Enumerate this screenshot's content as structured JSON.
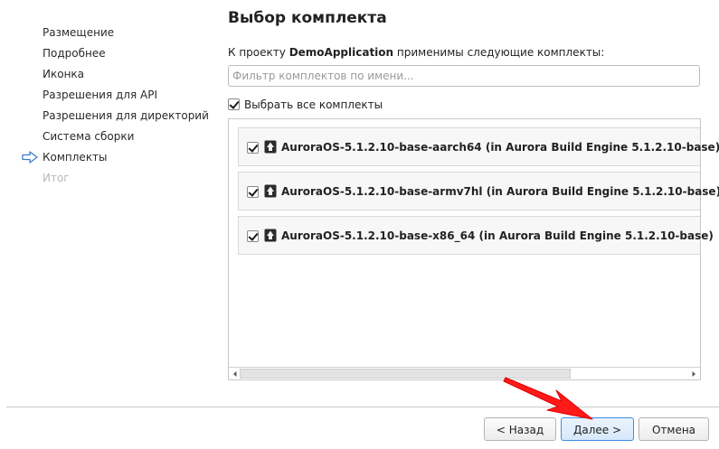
{
  "sidebar": {
    "items": [
      {
        "label": "Размещение"
      },
      {
        "label": "Подробнее"
      },
      {
        "label": "Иконка"
      },
      {
        "label": "Разрешения для API"
      },
      {
        "label": "Разрешения для директорий"
      },
      {
        "label": "Система сборки"
      },
      {
        "label": "Комплекты"
      },
      {
        "label": "Итог"
      }
    ],
    "current_index": 6,
    "current_icon": "right-arrow-icon"
  },
  "page": {
    "title": "Выбор комплекта",
    "intro_prefix": "К проекту ",
    "project_name": "DemoApplication",
    "intro_suffix": " применимы следующие комплекты:",
    "filter_placeholder": "Фильтр комплектов по имени...",
    "select_all_label": "Выбрать все комплекты",
    "select_all_checked": true
  },
  "kits": [
    {
      "label": "AuroraOS-5.1.2.10-base-aarch64 (in Aurora Build Engine 5.1.2.10-base)",
      "checked": true,
      "icon": "aurora-kit-icon"
    },
    {
      "label": "AuroraOS-5.1.2.10-base-armv7hl (in Aurora Build Engine 5.1.2.10-base)",
      "checked": true,
      "icon": "aurora-kit-icon"
    },
    {
      "label": "AuroraOS-5.1.2.10-base-x86_64 (in Aurora Build Engine 5.1.2.10-base)",
      "checked": true,
      "icon": "aurora-kit-icon"
    }
  ],
  "footer": {
    "back_label": "< Назад",
    "next_label": "Далее >",
    "cancel_label": "Отмена"
  },
  "colors": {
    "accent": "#3d8ee0",
    "annotation_arrow": "#ff1a1a",
    "disabled_text": "#b9b9b9"
  }
}
